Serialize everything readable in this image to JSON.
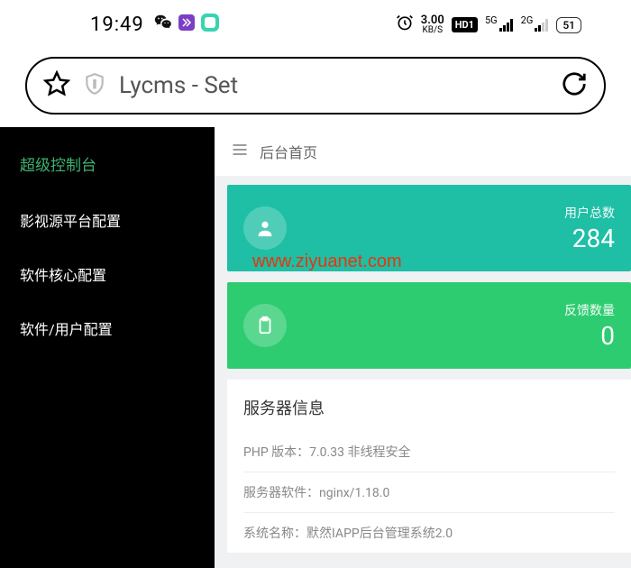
{
  "statusbar": {
    "time": "19:49",
    "kbs_value": "3.00",
    "kbs_unit": "KB/S",
    "hd_label": "HD1",
    "sig1": "5G",
    "sig2": "2G",
    "battery": "51"
  },
  "urlbar": {
    "title": "Lycms - Set"
  },
  "sidebar": {
    "title": "超级控制台",
    "items": [
      {
        "label": "影视源平台配置"
      },
      {
        "label": "软件核心配置"
      },
      {
        "label": "软件/用户配置"
      }
    ]
  },
  "main": {
    "header_title": "后台首页",
    "cards": [
      {
        "label": "用户总数",
        "value": "284"
      },
      {
        "label": "反馈数量",
        "value": "0"
      }
    ],
    "info": {
      "title": "服务器信息",
      "rows": [
        {
          "k": "PHP 版本：",
          "v": "7.0.33 非线程安全"
        },
        {
          "k": "服务器软件：",
          "v": "nginx/1.18.0"
        },
        {
          "k": "系统名称：",
          "v": "默然IAPP后台管理系统2.0"
        }
      ]
    }
  },
  "watermark": "www.ziyuanet.com"
}
